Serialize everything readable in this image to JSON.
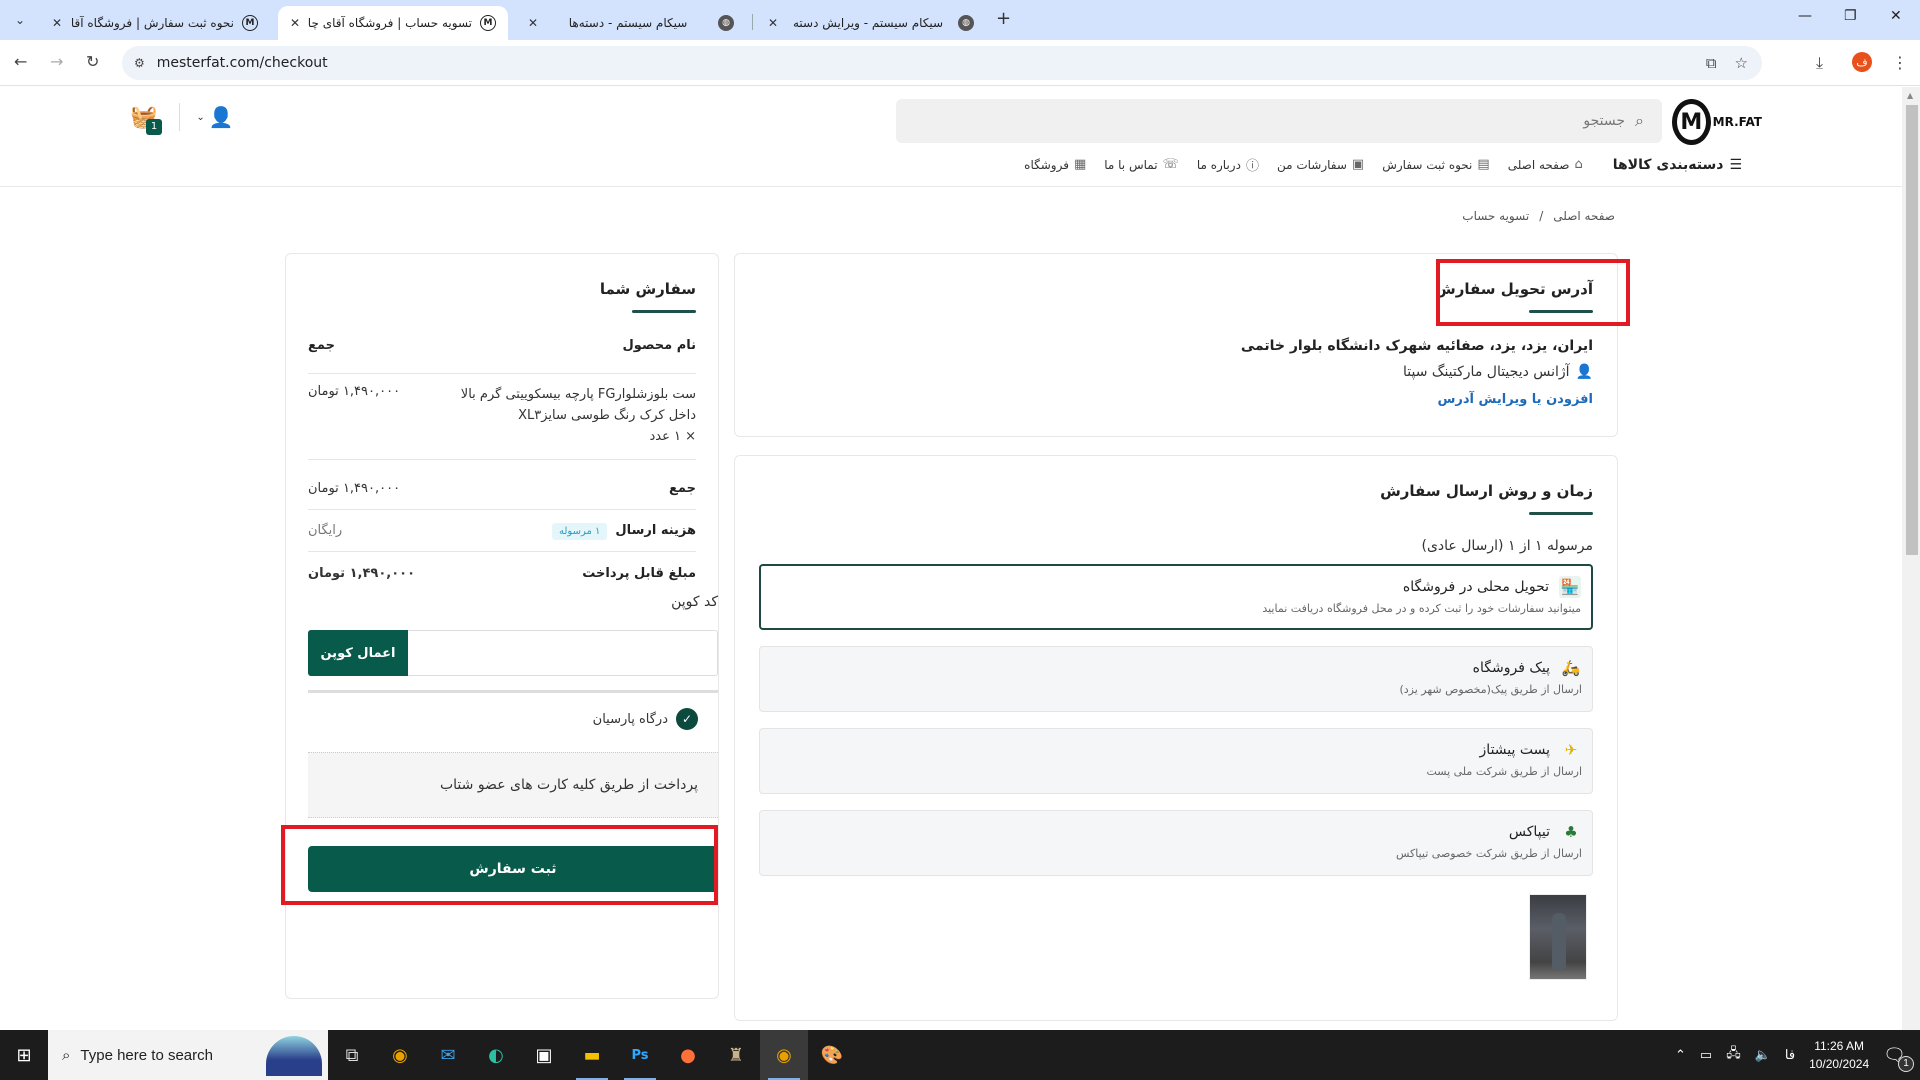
{
  "browser": {
    "tabs": [
      {
        "title": "نحوه ثبت سفارش | فروشگاه آقای",
        "favicon": "mrfat-logo-icon",
        "active": false
      },
      {
        "title": "تسویه حساب | فروشگاه آقای چاق",
        "favicon": "mrfat-logo-icon",
        "active": true
      },
      {
        "title": "سیکام سیستم - دسته‌ها",
        "favicon": "globe-icon",
        "active": false
      },
      {
        "title": "سیکام سیستم - ویرایش دسته",
        "favicon": "globe-icon",
        "active": false
      }
    ],
    "close_glyph": "✕",
    "new_tab_glyph": "+",
    "url": "mesterfat.com/checkout",
    "profile_initial": "ف"
  },
  "site": {
    "logo_text": "MR.FAT",
    "search_placeholder": "جستجو",
    "cart_count": "1",
    "nav": {
      "categories_label": "دسته‌بندی کالاها",
      "items": [
        {
          "label": "صفحه اصلی",
          "icon": "home-icon"
        },
        {
          "label": "نحوه ثبت سفارش",
          "icon": "document-icon"
        },
        {
          "label": "سفارشات من",
          "icon": "box-icon"
        },
        {
          "label": "درباره ما",
          "icon": "info-icon"
        },
        {
          "label": "تماس با ما",
          "icon": "phone-icon"
        },
        {
          "label": "فروشگاه",
          "icon": "store-icon"
        }
      ]
    },
    "breadcrumb": {
      "home": "صفحه اصلی",
      "separator": "/",
      "current": "تسویه حساب"
    }
  },
  "address": {
    "title": "آدرس تحویل سفارش",
    "line": "ایران، یزد، یزد، صفائیه شهرک دانشگاه بلوار خاتمی",
    "recipient": "آژانس دیجیتال مارکتینگ سپتا",
    "edit_link": "افزودن یا ویرایش آدرس"
  },
  "shipping": {
    "title": "زمان و روش ارسال سفارش",
    "parcel_label": "مرسوله ۱ از ۱ (ارسال عادی)",
    "options": [
      {
        "name": "تحویل محلی در فروشگاه",
        "desc": "میتوانید سفارشات خود را ثبت کرده و در محل فروشگاه دریافت نمایید",
        "icon": "store-pickup-icon",
        "selected": true
      },
      {
        "name": "پیک فروشگاه",
        "desc": "ارسال از طریق پیک(مخصوص شهر یزد)",
        "icon": "courier-scooter-icon",
        "selected": false
      },
      {
        "name": "پست پیشتاز",
        "desc": "ارسال از طریق شرکت ملی پست",
        "icon": "post-icon",
        "selected": false
      },
      {
        "name": "تیپاکس",
        "desc": "ارسال از طریق شرکت خصوصی تیپاکس",
        "icon": "tipax-icon",
        "selected": false
      }
    ]
  },
  "order": {
    "title": "سفارش شما",
    "col_product": "نام محصول",
    "col_total": "جمع",
    "item_name": "ست بلوزشلوارFG پارچه بیسکوییتی گرم بالا داخل کرک رنگ طوسی سایزXL۳",
    "item_qty": "× ۱ عدد",
    "item_price": "۱,۴۹۰,۰۰۰ تومان",
    "subtotal_label": "جمع",
    "subtotal_value": "۱,۴۹۰,۰۰۰ تومان",
    "shipping_label": "هزینه ارسال",
    "shipping_badge": "۱ مرسوله",
    "shipping_value": "رایگان",
    "payable_label": "مبلغ قابل پرداخت",
    "payable_value": "۱,۴۹۰,۰۰۰ تومان",
    "coupon_label": "کد کوپن",
    "coupon_value": "",
    "coupon_button": "اعمال کوپن",
    "gateway_name": "درگاه پارسیان",
    "gateway_desc": "پرداخت از طریق کلیه کارت های عضو شتاب",
    "submit_button": "ثبت سفارش"
  },
  "taskbar": {
    "search_placeholder": "Type here to search",
    "time": "11:26 AM",
    "date": "10/20/2024",
    "lang": "فا",
    "notifications": "1"
  }
}
